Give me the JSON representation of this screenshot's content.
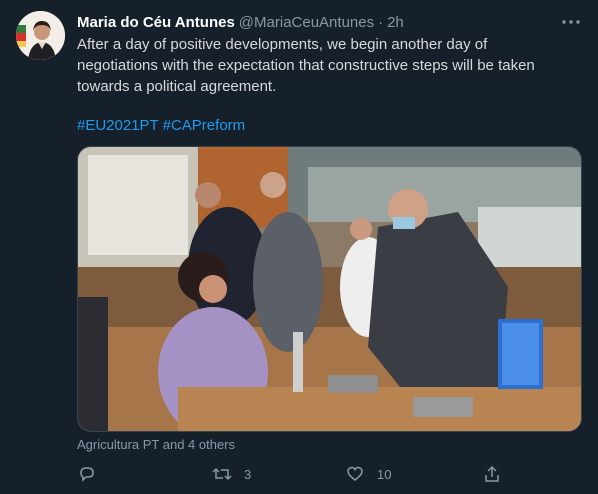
{
  "tweet": {
    "author_name": "Maria do Céu Antunes",
    "handle": "@MariaCeuAntunes",
    "separator": "·",
    "time": "2h",
    "text": "After a day of positive developments, we begin another day of negotiations with the expectation that constructive steps will be taken towards a political agreement.",
    "hashtags": [
      "#EU2021PT",
      "#CAPreform"
    ],
    "liked_by": "Agricultura PT and 4 others",
    "image_alt": "Photo of politicians negotiating in a parliamentary chamber"
  },
  "actions": {
    "reply_icon": "reply-icon",
    "retweet_icon": "retweet-icon",
    "retweet_count": "3",
    "like_icon": "heart-icon",
    "like_count": "10",
    "share_icon": "share-icon"
  },
  "colors": {
    "background": "#15202b",
    "text": "#d9d9d9",
    "muted": "#8899a6",
    "link": "#1d9bf0"
  }
}
